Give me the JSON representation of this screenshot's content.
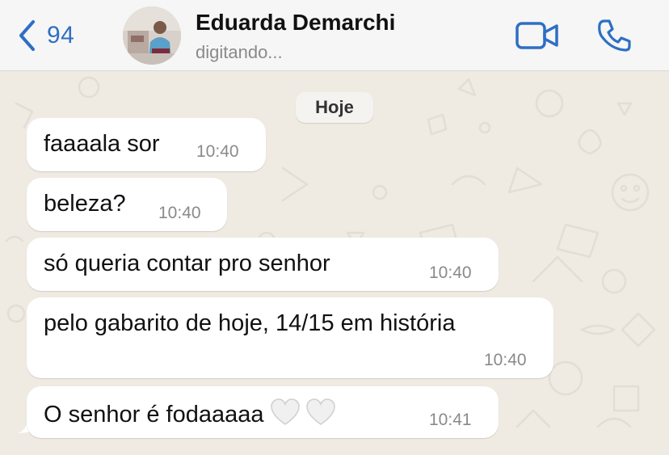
{
  "header": {
    "back_count": "94",
    "contact_name": "Eduarda Demarchi",
    "contact_status": "digitando...",
    "accent_color": "#2e6fc4"
  },
  "chat": {
    "date_label": "Hoje",
    "messages": [
      {
        "text": "faaaala sor",
        "time": "10:40"
      },
      {
        "text": "beleza?",
        "time": "10:40"
      },
      {
        "text": "só queria contar pro senhor",
        "time": "10:40"
      },
      {
        "text": "pelo gabarito de hoje, 14/15 em história",
        "time": "10:40"
      },
      {
        "text": "O senhor é fodaaaaa",
        "time": "10:41",
        "emoji": [
          "white-heart",
          "white-heart"
        ]
      }
    ]
  }
}
